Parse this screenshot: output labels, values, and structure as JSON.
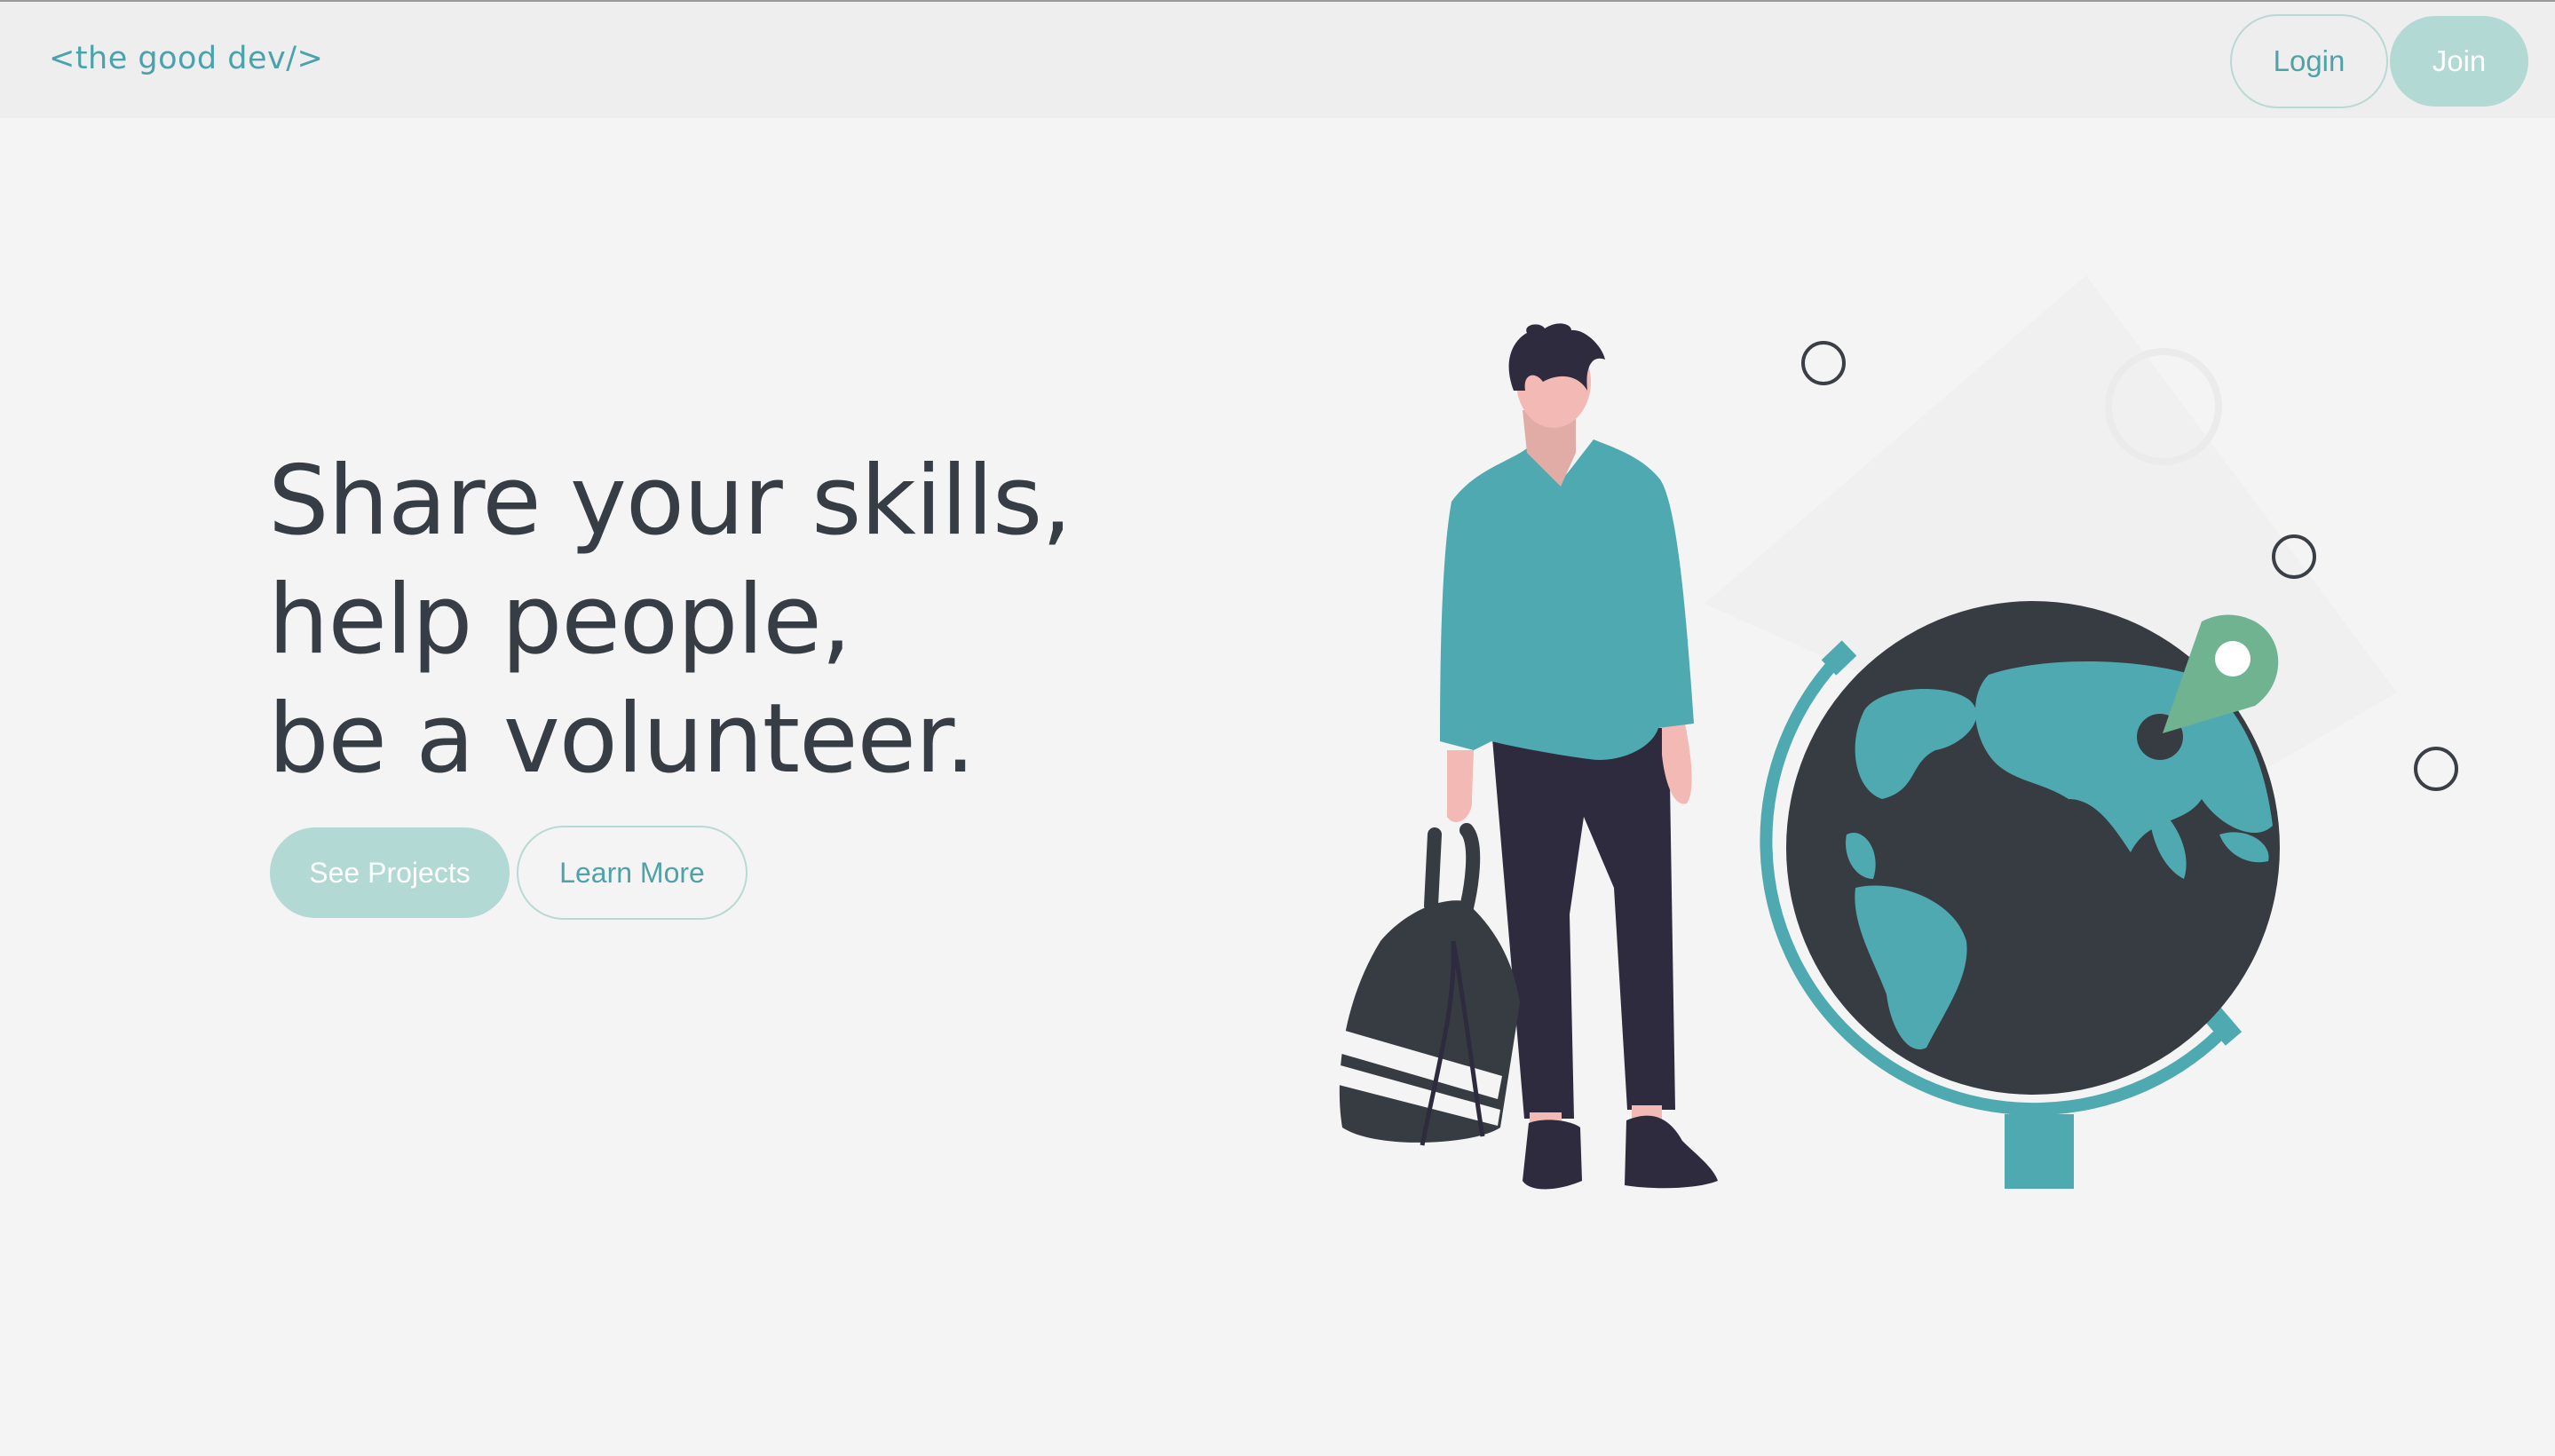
{
  "header": {
    "logo": "<the good dev/>",
    "login_label": "Login",
    "join_label": "Join"
  },
  "hero": {
    "title_lines": [
      "Share your skills,",
      "help people,",
      "be a volunteer."
    ],
    "primary_cta": "See Projects",
    "secondary_cta": "Learn More"
  },
  "illustration": {
    "subject": "person with backpack standing next to globe with location pin",
    "icons": [
      "person-figure",
      "backpack-icon",
      "globe-icon",
      "location-pin-icon"
    ]
  },
  "colors": {
    "accent": "#4fa2a8",
    "accent_light": "#b2d9d4",
    "dark": "#373d44",
    "background": "#f4f4f4",
    "header_bg": "#eeeeee"
  }
}
